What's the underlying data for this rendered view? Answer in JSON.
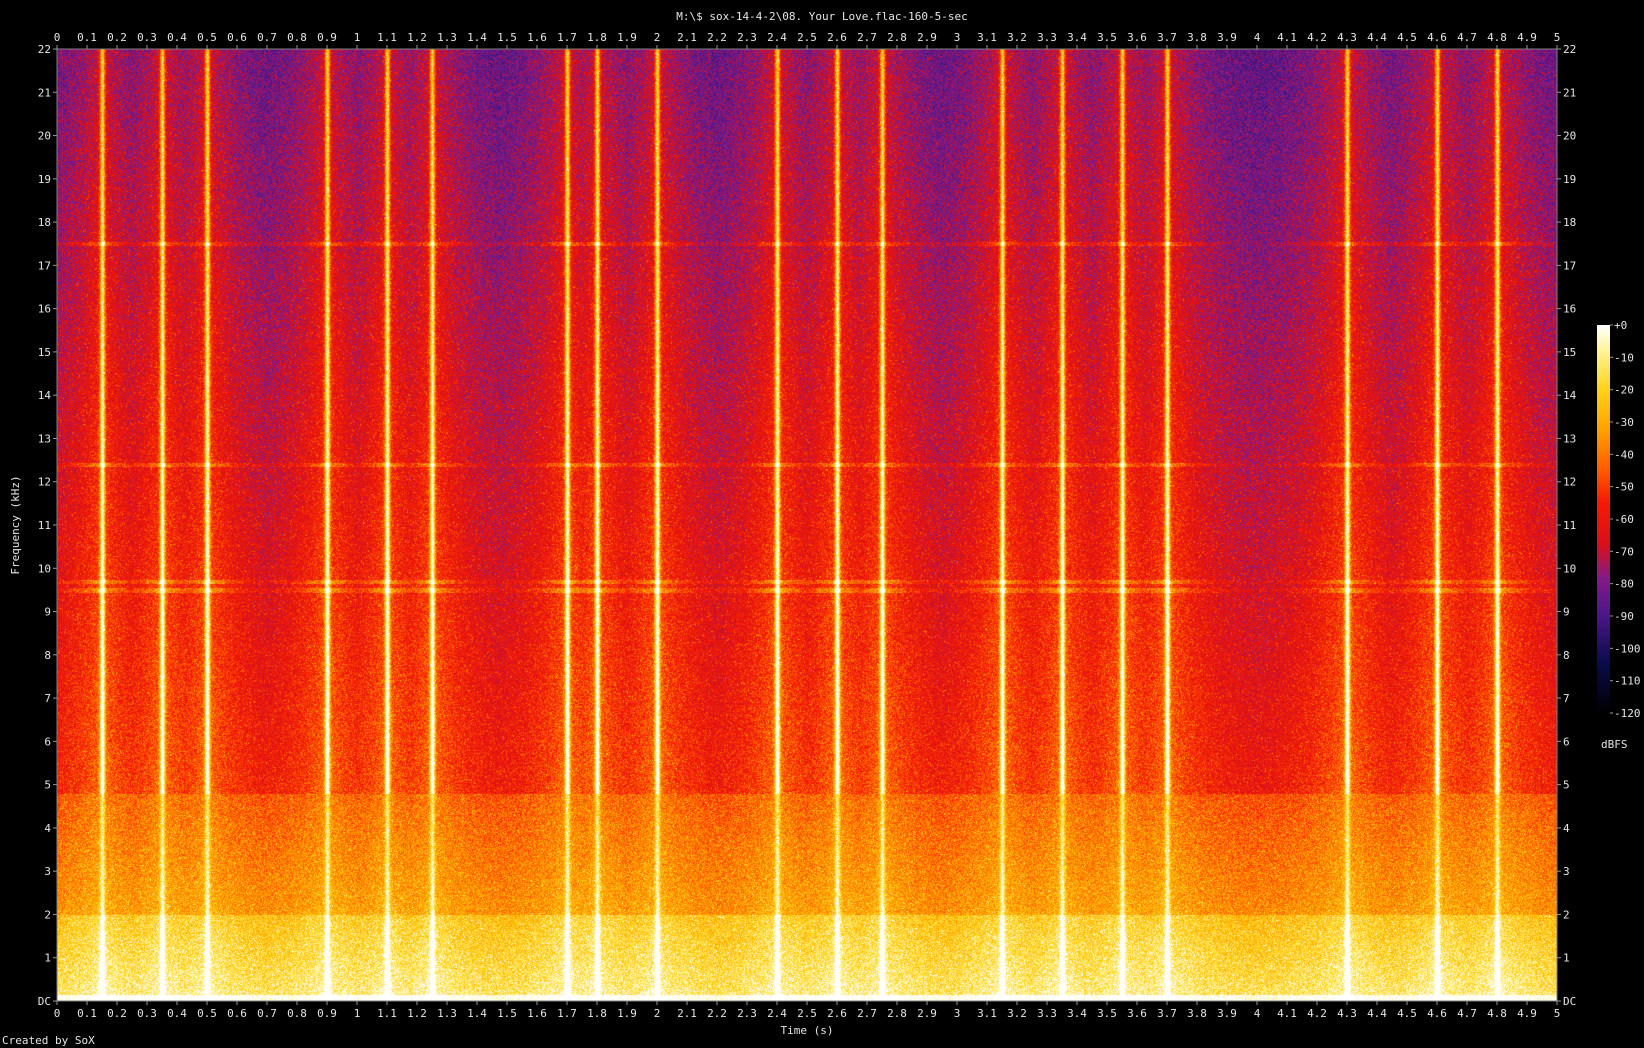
{
  "chart_data": {
    "type": "heatmap",
    "title": "M:\\$ sox-14-4-2\\08. Your Love.flac-160-5-sec",
    "xlabel": "Time (s)",
    "ylabel": "Frequency (kHz)",
    "footer": "Created by SoX",
    "x_ticks": [
      "0",
      "0.1",
      "0.2",
      "0.3",
      "0.4",
      "0.5",
      "0.6",
      "0.7",
      "0.8",
      "0.9",
      "1",
      "1.1",
      "1.2",
      "1.3",
      "1.4",
      "1.5",
      "1.6",
      "1.7",
      "1.8",
      "1.9",
      "2",
      "2.1",
      "2.2",
      "2.3",
      "2.4",
      "2.5",
      "2.6",
      "2.7",
      "2.8",
      "2.9",
      "3",
      "3.1",
      "3.2",
      "3.3",
      "3.4",
      "3.5",
      "3.6",
      "3.7",
      "3.8",
      "3.9",
      "4",
      "4.1",
      "4.2",
      "4.3",
      "4.4",
      "4.5",
      "4.6",
      "4.7",
      "4.8",
      "4.9",
      "5"
    ],
    "xlim": [
      0,
      5
    ],
    "y_ticks": [
      "DC",
      "1",
      "2",
      "3",
      "4",
      "5",
      "6",
      "7",
      "8",
      "9",
      "10",
      "11",
      "12",
      "13",
      "14",
      "15",
      "16",
      "17",
      "18",
      "19",
      "20",
      "21",
      "22"
    ],
    "ylim": [
      0,
      22
    ],
    "colorbar": {
      "label": "dBFS",
      "ticks": [
        "+0",
        "-10",
        "-20",
        "-30",
        "-40",
        "-50",
        "-60",
        "-70",
        "-80",
        "-90",
        "-100",
        "-110",
        "-120"
      ],
      "range": [
        -120,
        0
      ]
    },
    "colormap_stops": [
      {
        "db": -120,
        "color": "#000000"
      },
      {
        "db": -105,
        "color": "#0a0a4a"
      },
      {
        "db": -90,
        "color": "#4a1688"
      },
      {
        "db": -78,
        "color": "#861a86"
      },
      {
        "db": -68,
        "color": "#d8101a"
      },
      {
        "db": -55,
        "color": "#f51a06"
      },
      {
        "db": -45,
        "color": "#ff5a00"
      },
      {
        "db": -32,
        "color": "#ffa300"
      },
      {
        "db": -20,
        "color": "#ffd218"
      },
      {
        "db": -8,
        "color": "#fff39a"
      },
      {
        "db": 0,
        "color": "#ffffff"
      }
    ],
    "transient_times_s": [
      0.15,
      0.35,
      0.5,
      0.9,
      1.1,
      1.25,
      1.7,
      1.8,
      2.0,
      2.4,
      2.6,
      2.75,
      3.15,
      3.35,
      3.55,
      3.7,
      4.3,
      4.6,
      4.8
    ],
    "tonal_lines_khz": [
      17.5,
      12.4,
      9.7,
      9.5
    ]
  }
}
